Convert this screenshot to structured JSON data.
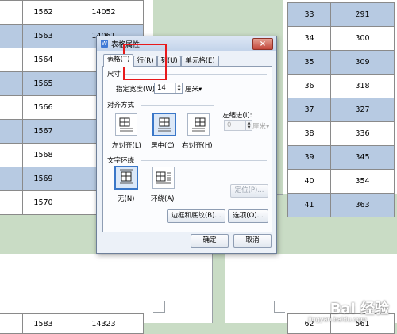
{
  "left_table": {
    "rows": [
      {
        "num": "1562",
        "val": "14052",
        "shade": false
      },
      {
        "num": "1563",
        "val": "14061",
        "shade": true
      },
      {
        "num": "1564",
        "val": "",
        "shade": false
      },
      {
        "num": "1565",
        "val": "",
        "shade": true
      },
      {
        "num": "1566",
        "val": "",
        "shade": false
      },
      {
        "num": "1567",
        "val": "",
        "shade": true
      },
      {
        "num": "1568",
        "val": "",
        "shade": false
      },
      {
        "num": "1569",
        "val": "",
        "shade": true
      },
      {
        "num": "1570",
        "val": "",
        "shade": false
      }
    ],
    "bottom_row": {
      "num": "1583",
      "val": "14323"
    }
  },
  "right_table": {
    "rows": [
      {
        "num": "33",
        "val": "291",
        "shade": true
      },
      {
        "num": "34",
        "val": "300",
        "shade": false
      },
      {
        "num": "35",
        "val": "309",
        "shade": true
      },
      {
        "num": "36",
        "val": "318",
        "shade": false
      },
      {
        "num": "37",
        "val": "327",
        "shade": true
      },
      {
        "num": "38",
        "val": "336",
        "shade": false
      },
      {
        "num": "39",
        "val": "345",
        "shade": true
      },
      {
        "num": "40",
        "val": "354",
        "shade": false
      },
      {
        "num": "41",
        "val": "363",
        "shade": true
      }
    ],
    "bottom_row": {
      "num": "62",
      "val": "561"
    }
  },
  "dialog": {
    "title": "表格属性",
    "close": "×",
    "tabs": [
      "表格(T)",
      "行(R)",
      "列(U)",
      "单元格(E)"
    ],
    "size_section": "尺寸",
    "width_label": "指定宽度(W):",
    "width_value": "14",
    "width_unit": "厘米▾",
    "align_section": "对齐方式",
    "align_options": [
      "左对齐(L)",
      "居中(C)",
      "右对齐(H)"
    ],
    "indent_label": "左缩进(I):",
    "indent_value": "0",
    "indent_unit": "厘米▾",
    "wrap_section": "文字环绕",
    "wrap_options": [
      "无(N)",
      "环绕(A)"
    ],
    "position_button": "定位(P)...",
    "borders_button": "边框和底纹(B)...",
    "options_button": "选项(O)...",
    "ok_button": "确定",
    "cancel_button": "取消"
  },
  "watermark": "Bai 经验",
  "watermark_url": "jingyan.baidu.com"
}
